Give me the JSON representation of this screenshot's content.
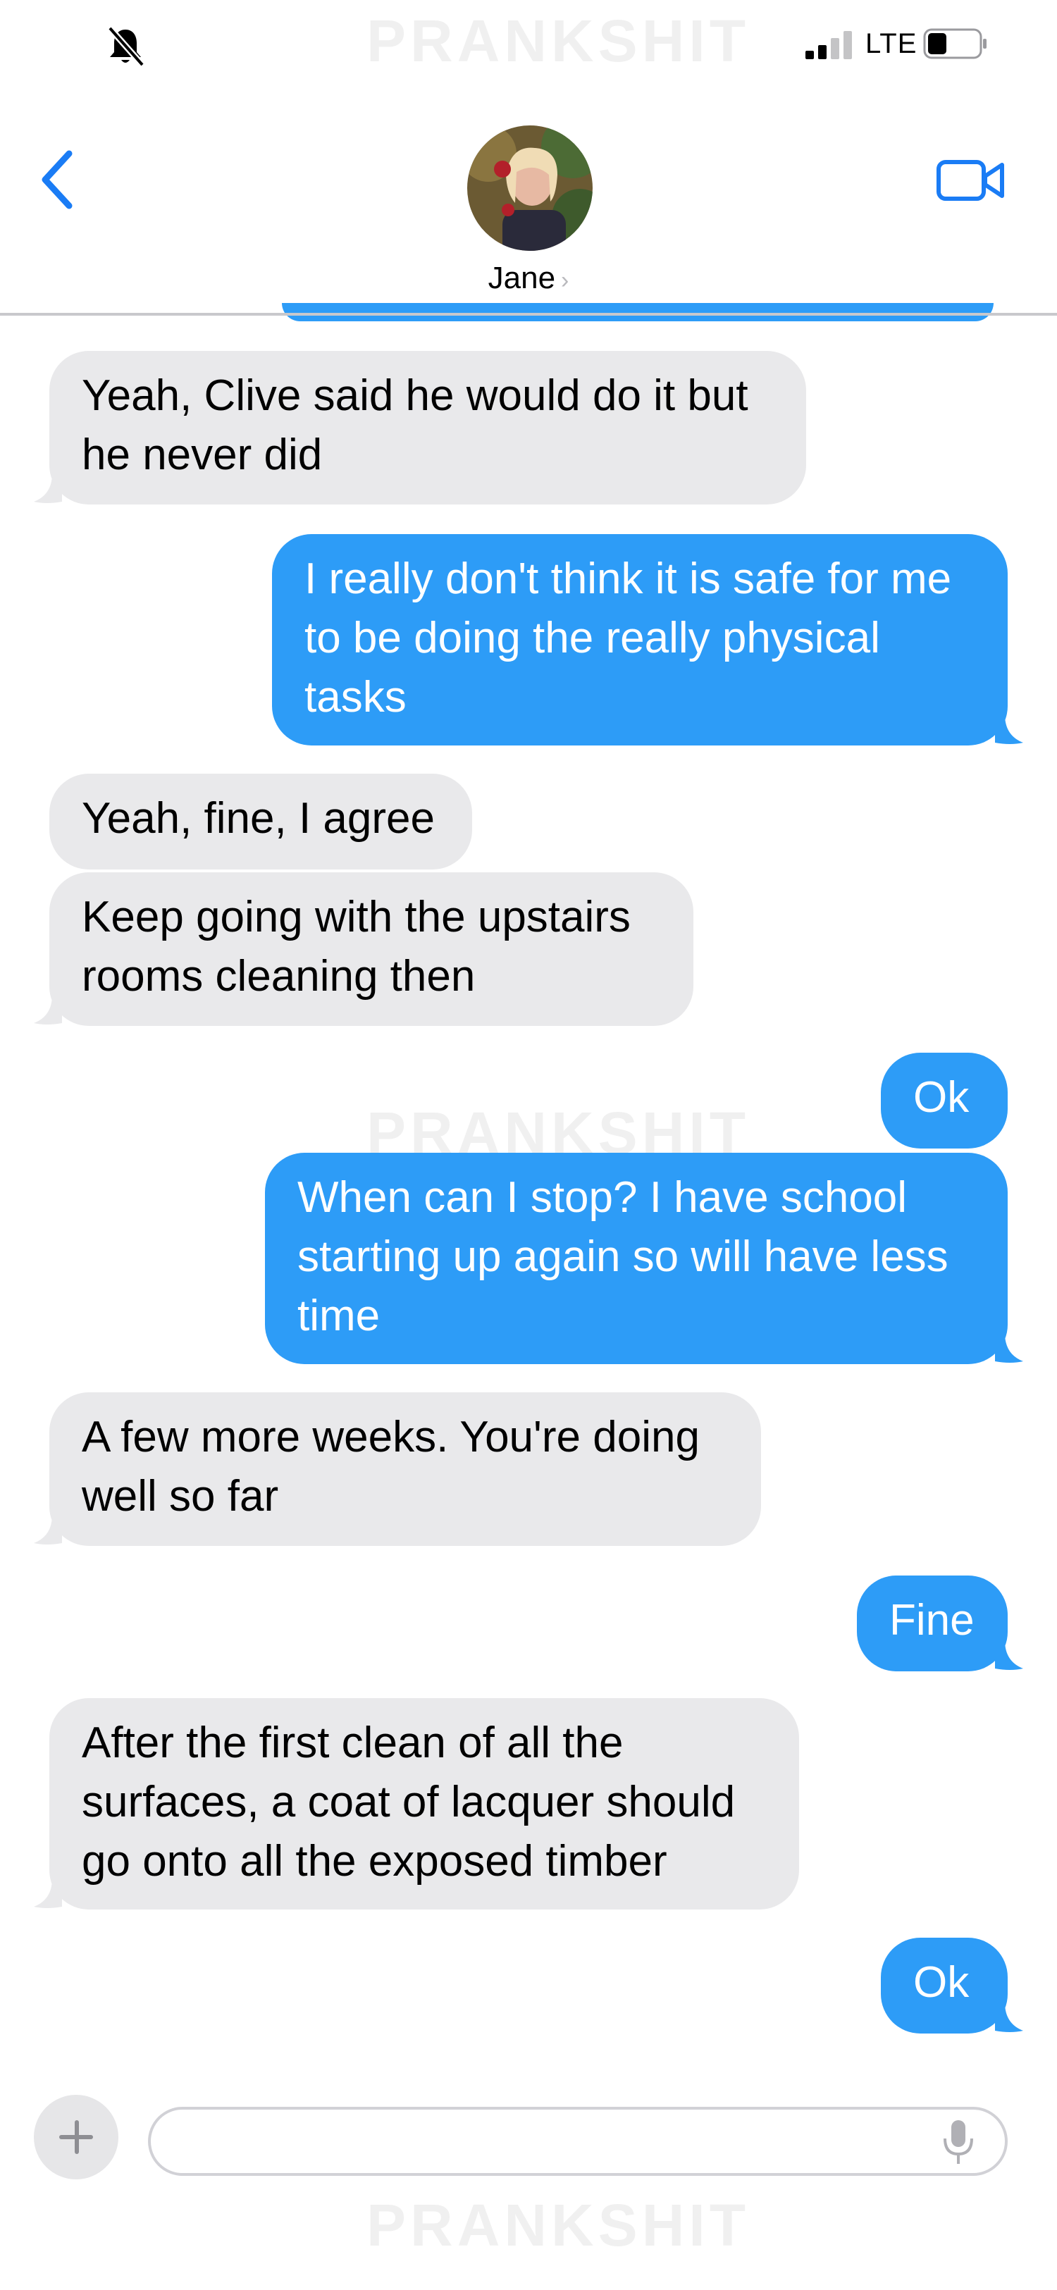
{
  "status_bar": {
    "network": "LTE",
    "icons": [
      "bell-slash-icon",
      "signal-bars-icon",
      "battery-icon"
    ]
  },
  "watermark": "PRANKSHIT",
  "header": {
    "contact_name": "Jane",
    "icons": [
      "back-chevron-icon",
      "video-camera-icon",
      "chevron-right-icon"
    ]
  },
  "messages": [
    {
      "side": "received",
      "text": "Yeah, Clive said he would do it but he never did"
    },
    {
      "side": "sent",
      "text": "I really don't think it is safe for me to be doing the really physical tasks"
    },
    {
      "side": "received",
      "text": "Yeah, fine, I agree"
    },
    {
      "side": "received",
      "text": "Keep going with the upstairs rooms cleaning then"
    },
    {
      "side": "sent",
      "text": "Ok"
    },
    {
      "side": "sent",
      "text": "When can I stop? I have school starting up again so will have less time"
    },
    {
      "side": "received",
      "text": "A few more weeks. You're doing well so far"
    },
    {
      "side": "sent",
      "text": "Fine"
    },
    {
      "side": "received",
      "text": "After the first clean of all the surfaces, a coat of lacquer should go onto all the exposed timber"
    },
    {
      "side": "sent",
      "text": "Ok"
    }
  ],
  "composer": {
    "value": "",
    "icons": [
      "plus-icon",
      "microphone-icon"
    ]
  },
  "colors": {
    "sent_bubble": "#2d9cf7",
    "received_bubble": "#e9e9eb",
    "accent": "#1a7cf5"
  }
}
